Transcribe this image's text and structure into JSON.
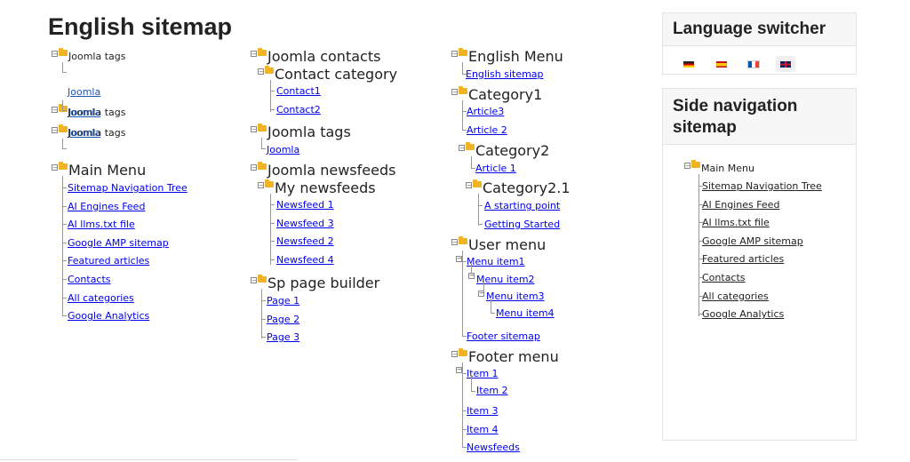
{
  "page": {
    "title": "English sitemap"
  },
  "col1": {
    "g1": {
      "label": "Joomla tags",
      "items": [
        "Joomla"
      ]
    },
    "g2": {
      "label": "Joomla tags",
      "items": [
        "Joomla"
      ]
    },
    "g3": {
      "label": "Joomla tags",
      "items": [
        "Joomla"
      ]
    },
    "main": {
      "label": "Main Menu",
      "items": [
        "Sitemap Navigation Tree",
        "AI Engines Feed",
        "AI llms.txt file",
        "Google AMP sitemap",
        "Featured articles",
        "Contacts",
        "All categories",
        "Google Analytics"
      ]
    }
  },
  "col2": {
    "contacts": {
      "label": "Joomla contacts",
      "category": "Contact category",
      "items": [
        "Contact1",
        "Contact2"
      ]
    },
    "tags": {
      "label": "Joomla tags",
      "items": [
        "Joomla"
      ]
    },
    "newsfeeds": {
      "label": "Joomla newsfeeds",
      "sub": "My newsfeeds",
      "items": [
        "Newsfeed 1",
        "Newsfeed 3",
        "Newsfeed 2",
        "Newsfeed 4"
      ]
    },
    "sp": {
      "label": "Sp page builder",
      "items": [
        "Page 1",
        "Page 2",
        "Page 3"
      ]
    }
  },
  "col3": {
    "english": {
      "label": "English Menu",
      "items": [
        "English sitemap"
      ]
    },
    "cat1": {
      "label": "Category1",
      "items": [
        "Article3",
        "Article 2"
      ]
    },
    "cat2": {
      "label": "Category2",
      "items": [
        "Article 1"
      ]
    },
    "cat21": {
      "label": "Category2.1",
      "items": [
        "A starting point",
        "Getting Started"
      ]
    },
    "user": {
      "label": "User menu",
      "items": [
        "Menu item1",
        "Menu item2",
        "Menu item3",
        "Menu item4",
        "Footer sitemap"
      ]
    },
    "footer": {
      "label": "Footer menu",
      "items": [
        "Item 1",
        "Item 2",
        "Item 3",
        "Item 4",
        "Newsfeeds"
      ]
    }
  },
  "language": {
    "title": "Language switcher",
    "flags": [
      {
        "icon": "flag-de-icon",
        "colors": [
          "#222222",
          "#dd0000",
          "#ffce00"
        ]
      },
      {
        "icon": "flag-es-icon",
        "colors": [
          "#c60b1e",
          "#ffc400"
        ]
      },
      {
        "icon": "flag-fr-icon",
        "colors": [
          "#0055a4",
          "#ffffff",
          "#ef4135"
        ]
      },
      {
        "icon": "flag-gb-icon",
        "colors": [
          "#012169",
          "#cf142b"
        ],
        "active": true
      }
    ]
  },
  "side": {
    "title": "Side navigation sitemap",
    "main": {
      "label": "Main Menu",
      "items": [
        "Sitemap Navigation Tree",
        "AI Engines Feed",
        "AI llms.txt file",
        "Google AMP sitemap",
        "Featured articles",
        "Contacts",
        "All categories",
        "Google Analytics"
      ]
    }
  },
  "colors": {
    "link": "#1a55b8",
    "active_link": "#d62020",
    "folder": "#f0b323"
  }
}
